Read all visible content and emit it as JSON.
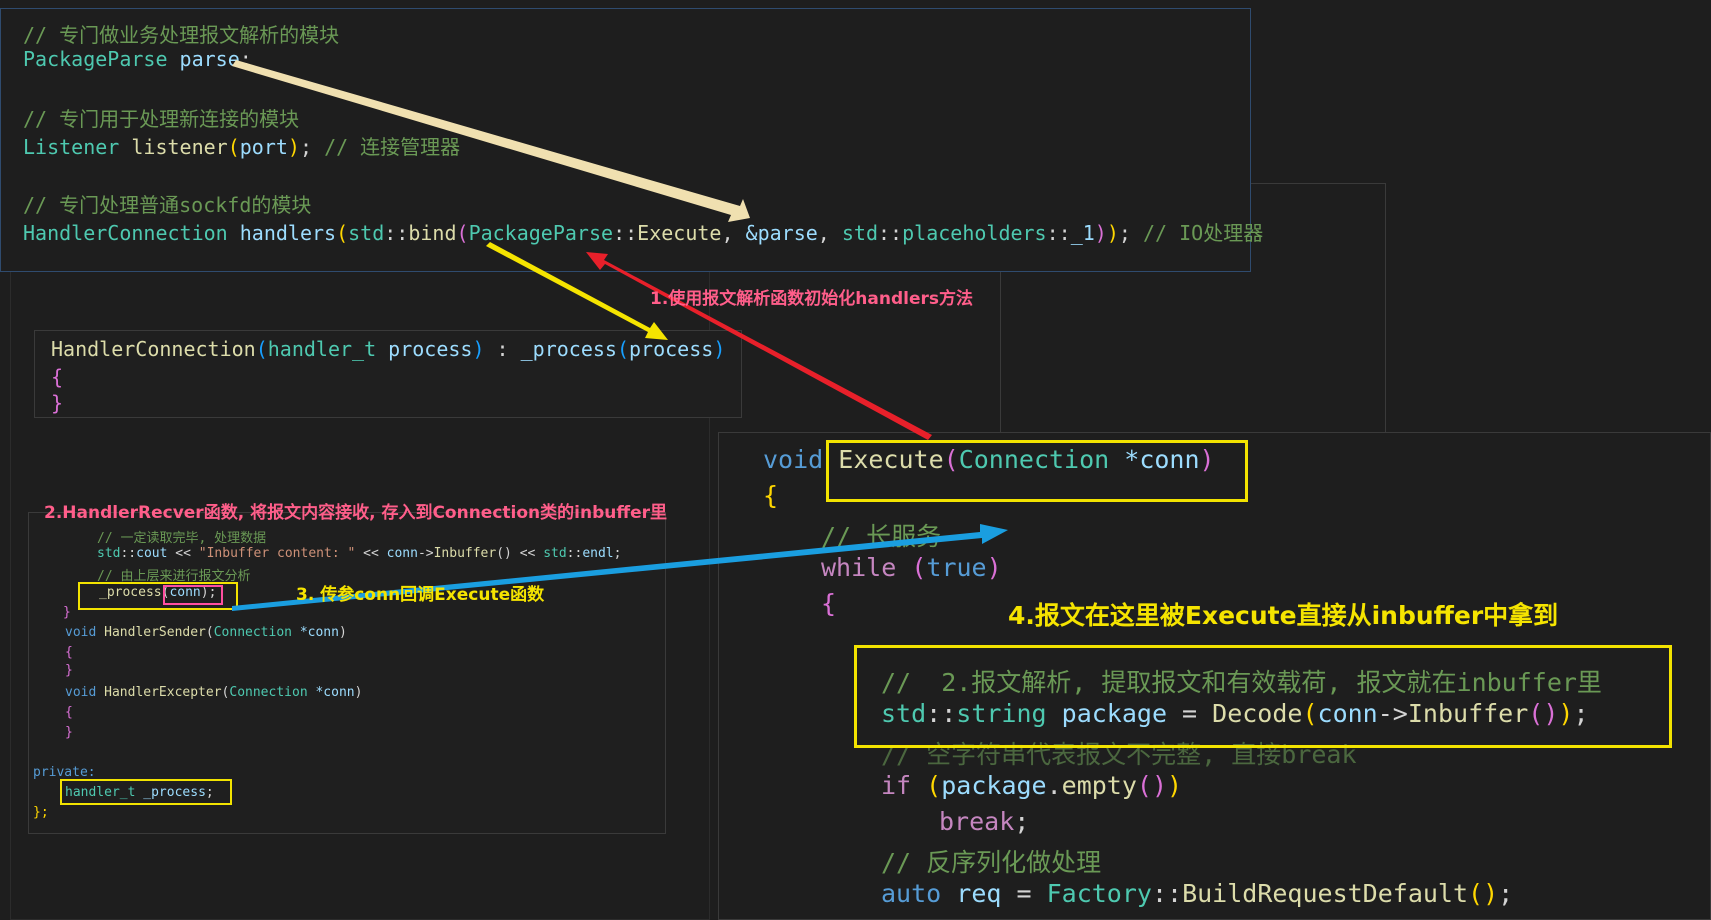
{
  "top_code": {
    "l1": "// 专门做业务处理报文解析的模块",
    "l2a": "PackageParse",
    "l2b": "parse",
    "l3": "// 专门用于处理新连接的模块",
    "l4a": "Listener",
    "l4b": "listener",
    "l4c": "port",
    "l4d": "// 连接管理器",
    "l5": "// 专门处理普通sockfd的模块",
    "l6a": "HandlerConnection",
    "l6b": "handlers",
    "l6c": "std",
    "l6d": "bind",
    "l6e": "PackageParse",
    "l6f": "Execute",
    "l6g": "&parse",
    "l6h": "std",
    "l6i": "placeholders",
    "l6j": "_1",
    "l6k": "// IO处理器"
  },
  "ctor_code": {
    "a": "HandlerConnection",
    "b": "handler_t",
    "c": "process",
    "d": "_process",
    "e": "process"
  },
  "handler_code": {
    "l1": "// 一定读取完毕, 处理数据",
    "l2a": "std",
    "l2b": "cout",
    "l2c": "\"Inbuffer content: \"",
    "l2d": "conn",
    "l2e": "Inbuffer",
    "l2f": "std",
    "l2g": "endl",
    "l3": "// 由上层来进行报文分析",
    "l4a": "_process",
    "l4b": "conn",
    "l5a": "void",
    "l5b": "HandlerSender",
    "l5c": "Connection",
    "l5d": "*conn",
    "l6a": "void",
    "l6b": "HandlerExcepter",
    "l6c": "Connection",
    "l6d": "*conn",
    "l7": "private:",
    "l8a": "handler_t",
    "l8b": "_process"
  },
  "exec_code": {
    "l1a": "void",
    "l1b": "Execute",
    "l1c": "Connection",
    "l1d": "*conn",
    "l2": "// 长服务",
    "l3a": "while",
    "l3b": "true",
    "l4": "//  2.报文解析, 提取报文和有效载荷, 报文就在inbuffer里",
    "l5a": "std",
    "l5b": "string",
    "l5c": "package",
    "l5d": "Decode",
    "l5e": "conn",
    "l5f": "Inbuffer",
    "l6": "// 空字符串代表报文不完整, 直接break",
    "l7a": "if",
    "l7b": "package",
    "l7c": "empty",
    "l8": "break",
    "l9": "// 反序列化做处理",
    "l10a": "auto",
    "l10b": "req",
    "l10c": "Factory",
    "l10d": "BuildRequestDefault"
  },
  "annotations": {
    "a1": "1.使用报文解析函数初始化handlers方法",
    "a2": "2.HandlerRecver函数, 将报文内容接收, 存入到Connection类的inbuffer里",
    "a3": "3. 传参conn回调Execute函数",
    "a4": "4.报文在这里被Execute直接从inbuffer中拿到"
  },
  "colors": {
    "arrow1": "#f0e0b0",
    "arrow_red": "#e8202a",
    "arrow_yellow": "#f5e400",
    "arrow_blue": "#1a9ee0",
    "ann_pink": "#ff5e8a"
  }
}
